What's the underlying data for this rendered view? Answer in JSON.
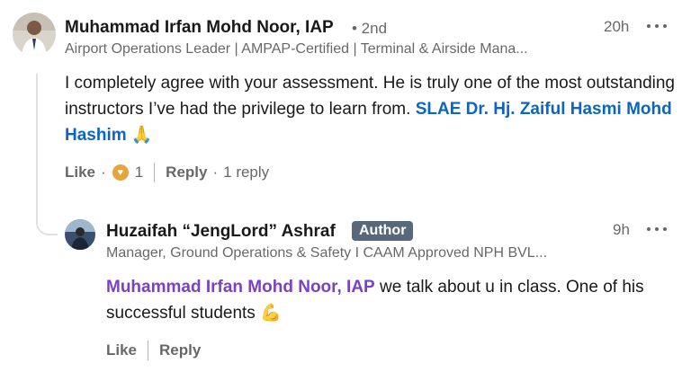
{
  "comment": {
    "author": "Muhammad Irfan Mohd Noor, IAP",
    "degree": "• 2nd",
    "headline": "Airport Operations Leader | AMPAP-Certified | Terminal & Airside Mana...",
    "time": "20h",
    "text_main": "I completely agree with your assessment. He is truly one of the most outstanding instructors I’ve had the privilege to learn from. ",
    "mention": "SLAE Dr. Hj. Zaiful Hasmi Mohd Hashim",
    "emoji": "🙏",
    "like_label": "Like",
    "dot": "·",
    "reaction_count": "1",
    "reply_label": "Reply",
    "reply_count": "1 reply"
  },
  "reply": {
    "author": "Huzaifah “JengLord” Ashraf",
    "badge": "Author",
    "headline": "Manager, Ground Operations & Safety I CAAM Approved NPH BVL...",
    "time": "9h",
    "mention": "Muhammad Irfan Mohd Noor, IAP",
    "text_main": " we talk about u in class. One of his successful students ",
    "emoji": "💪",
    "like_label": "Like",
    "reply_label": "Reply"
  },
  "colors": {
    "mention_blue": "#0a66c2",
    "mention_purple": "#7b40c4",
    "badge_bg": "#56687a",
    "reaction": "#e7a33e"
  },
  "icons": {
    "more": "more-horizontal-icon",
    "reaction": "heart-reaction-icon"
  }
}
